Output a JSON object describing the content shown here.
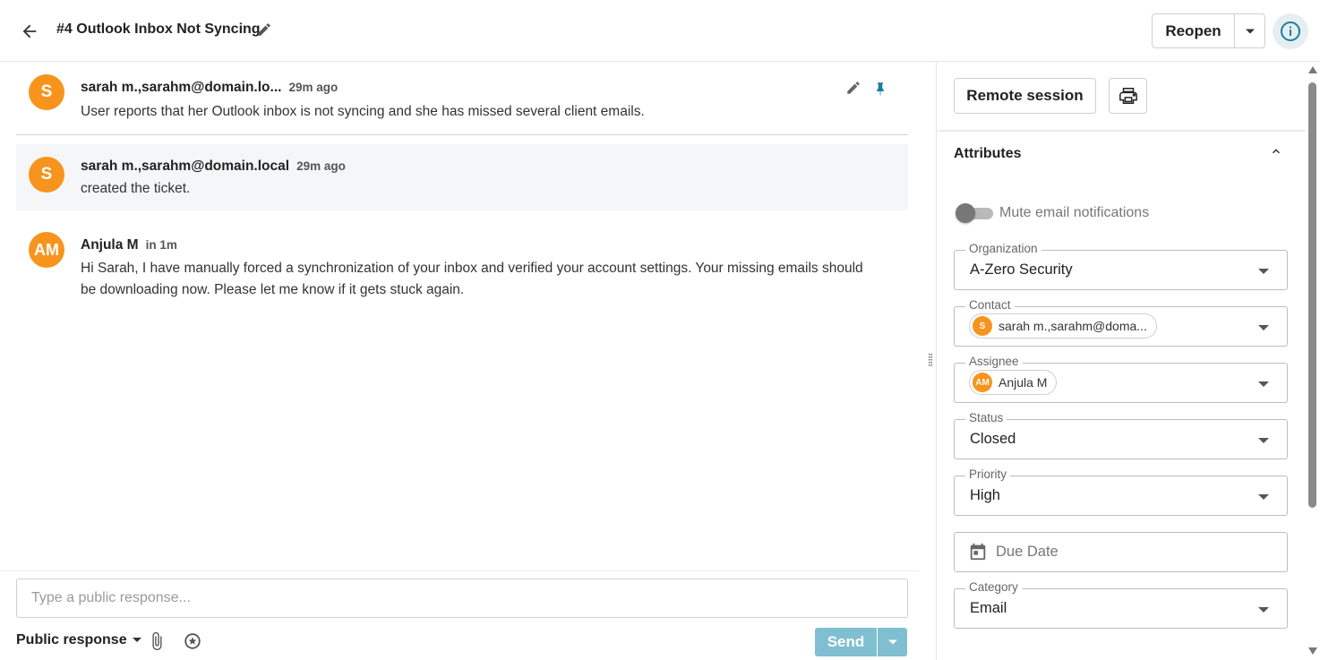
{
  "header": {
    "ticket_title": "#4 Outlook Inbox Not Syncing",
    "reopen_label": "Reopen"
  },
  "messages": [
    {
      "avatar": "S",
      "author": "sarah m.,sarahm@domain.lo...",
      "time": "29m ago",
      "body": "User reports that her Outlook inbox is not syncing and she has missed several client emails."
    },
    {
      "avatar": "S",
      "author": "sarah m.,sarahm@domain.local",
      "time": "29m ago",
      "body": "created the ticket."
    },
    {
      "avatar": "AM",
      "author": "Anjula M",
      "time": "in 1m",
      "body": "Hi Sarah, I have manually forced a synchronization of your inbox and verified your account settings. Your missing emails should be downloading now. Please let me know if it gets stuck again."
    }
  ],
  "composer": {
    "placeholder": "Type a public response...",
    "response_type": "Public response",
    "send_label": "Send"
  },
  "panel": {
    "remote_session_label": "Remote session",
    "attributes_title": "Attributes",
    "mute_label": "Mute email notifications",
    "mute_enabled": false,
    "organization": {
      "label": "Organization",
      "value": "A-Zero Security"
    },
    "contact": {
      "label": "Contact",
      "avatar": "S",
      "value": "sarah m.,sarahm@doma..."
    },
    "assignee": {
      "label": "Assignee",
      "avatar": "AM",
      "value": "Anjula M"
    },
    "status": {
      "label": "Status",
      "value": "Closed"
    },
    "priority": {
      "label": "Priority",
      "value": "High"
    },
    "due_date": {
      "placeholder": "Due Date"
    },
    "category": {
      "label": "Category",
      "value": "Email"
    }
  },
  "colors": {
    "avatar": "#f7941d",
    "accent": "#1a7fa0",
    "send_disabled": "#80bfd1"
  },
  "icons": [
    "back-arrow-icon",
    "pencil-icon",
    "chevron-down-icon",
    "info-icon",
    "pin-icon",
    "paperclip-icon",
    "macro-icon",
    "printer-icon",
    "chevron-up-icon",
    "calendar-icon"
  ]
}
